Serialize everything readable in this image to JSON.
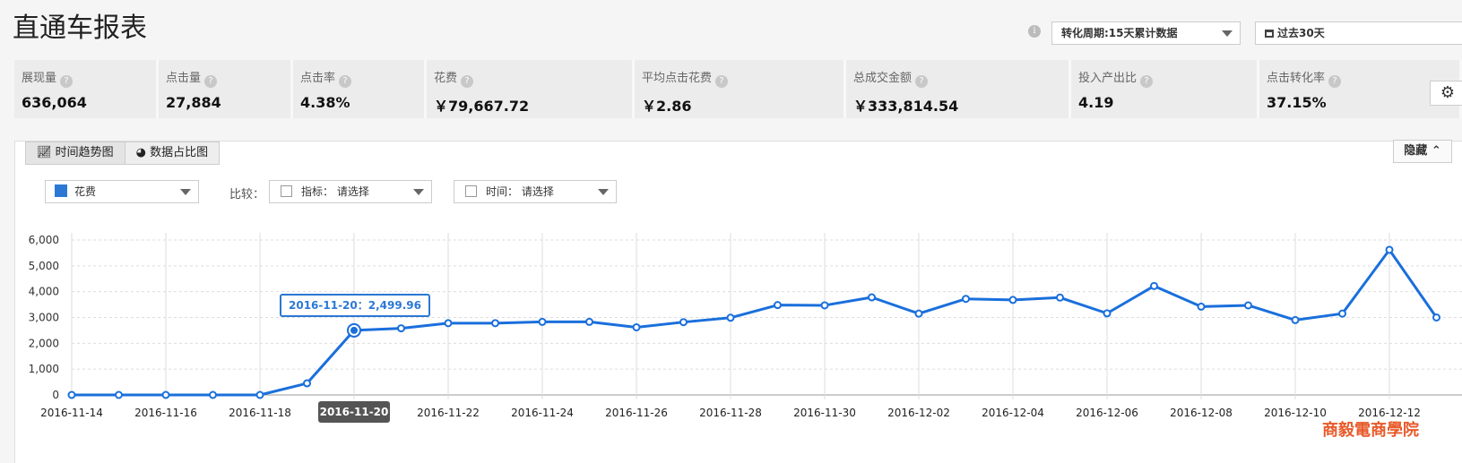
{
  "header": {
    "title": "直通车报表",
    "period_select": "转化周期:15天累计数据",
    "range_select": "过去30天"
  },
  "metrics": [
    {
      "label": "展现量",
      "value": "636,064"
    },
    {
      "label": "点击量",
      "value": "27,884"
    },
    {
      "label": "点击率",
      "value": "4.38%"
    },
    {
      "label": "花费",
      "value": "￥79,667.72"
    },
    {
      "label": "平均点击花费",
      "value": "￥2.86"
    },
    {
      "label": "总成交金额",
      "value": "￥333,814.54"
    },
    {
      "label": "投入产出比",
      "value": "4.19"
    },
    {
      "label": "点击转化率",
      "value": "37.15%"
    }
  ],
  "panel": {
    "tab_trend": "时间趋势图",
    "tab_pie": "数据占比图",
    "hide_label": "隐藏",
    "metric_select": "花费",
    "compare_label": "比较：",
    "indicator_select": "指标： 请选择",
    "time_select": "时间： 请选择"
  },
  "tooltip": "2016-11-20：2,499.96",
  "highlight_date": "2016-11-20",
  "logo_text": "商毅電商學院",
  "colors": {
    "series": "#1a6fdc",
    "accent": "#2b78d4"
  },
  "chart_data": {
    "type": "line",
    "x": [
      "2016-11-14",
      "2016-11-15",
      "2016-11-16",
      "2016-11-17",
      "2016-11-18",
      "2016-11-19",
      "2016-11-20",
      "2016-11-21",
      "2016-11-22",
      "2016-11-23",
      "2016-11-24",
      "2016-11-25",
      "2016-11-26",
      "2016-11-27",
      "2016-11-28",
      "2016-11-29",
      "2016-11-30",
      "2016-12-01",
      "2016-12-02",
      "2016-12-03",
      "2016-12-04",
      "2016-12-05",
      "2016-12-06",
      "2016-12-07",
      "2016-12-08",
      "2016-12-09",
      "2016-12-10",
      "2016-12-11",
      "2016-12-12",
      "2016-12-13"
    ],
    "x_tick_labels": [
      "2016-11-14",
      "2016-11-16",
      "2016-11-18",
      "2016-11-20",
      "2016-11-22",
      "2016-11-24",
      "2016-11-26",
      "2016-11-28",
      "2016-11-30",
      "2016-12-02",
      "2016-12-04",
      "2016-12-06",
      "2016-12-08",
      "2016-12-10",
      "2016-12-12"
    ],
    "series": [
      {
        "name": "花费",
        "values": [
          0,
          0,
          0,
          0,
          0,
          450,
          2499.96,
          2580,
          2780,
          2780,
          2830,
          2830,
          2620,
          2820,
          2990,
          3480,
          3470,
          3780,
          3150,
          3720,
          3680,
          3770,
          3160,
          4220,
          3420,
          3470,
          2900,
          3150,
          5620,
          3000
        ]
      }
    ],
    "y_ticks": [
      "6,000",
      "5,000",
      "4,000",
      "3,000",
      "2,000",
      "1,000",
      "0"
    ],
    "ylim": [
      0,
      6000
    ],
    "grid": true
  }
}
